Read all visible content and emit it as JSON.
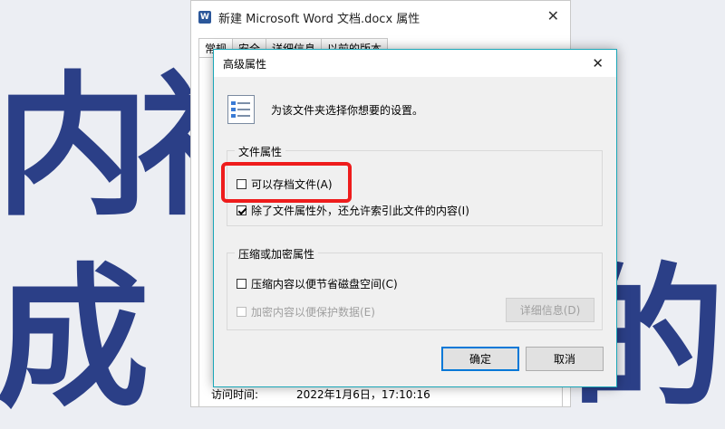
{
  "background": {
    "chars": [
      "内",
      "礼",
      "成",
      "的"
    ],
    "color": "#2b3f87"
  },
  "properties_window": {
    "title": "新建 Microsoft Word 文档.docx 属性",
    "app_icon": "word-icon",
    "app_icon_letter": "W",
    "tabs": [
      "常规",
      "安全",
      "详细信息",
      "以前的版本"
    ],
    "access_time_label": "访问时间:",
    "access_time_value": "2022年1月6日，17:10:16"
  },
  "dialog": {
    "title": "高级属性",
    "description": "为该文件夹选择你想要的设置。",
    "file_attributes": {
      "title": "文件属性",
      "archive_label": "可以存档文件(A)",
      "archive_checked": false,
      "index_label": "除了文件属性外，还允许索引此文件的内容(I)",
      "index_checked": true
    },
    "compress_encrypt": {
      "title": "压缩或加密属性",
      "compress_label": "压缩内容以便节省磁盘空间(C)",
      "compress_checked": false,
      "encrypt_label": "加密内容以便保护数据(E)",
      "encrypt_checked": false,
      "encrypt_disabled": true,
      "details_button": "详细信息(D)"
    },
    "ok_button": "确定",
    "cancel_button": "取消"
  },
  "highlight_color": "#ee1c1c",
  "accent_color": "#0078d7"
}
